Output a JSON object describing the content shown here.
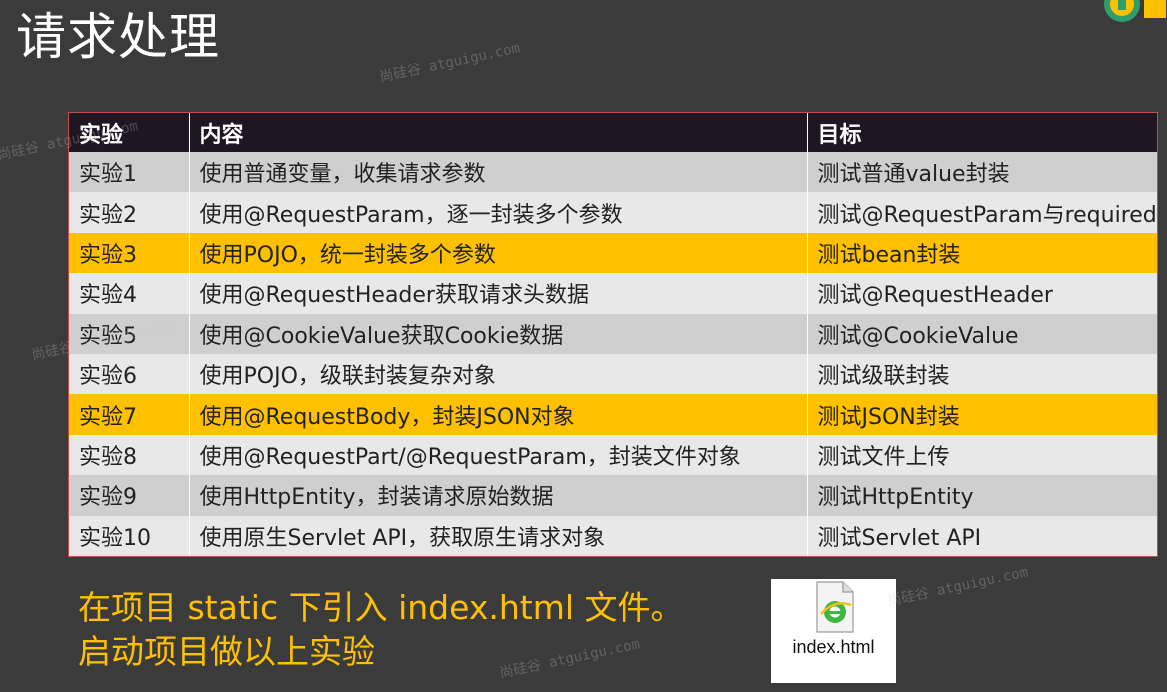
{
  "slide": {
    "title": "请求处理"
  },
  "table": {
    "headers": [
      "实验",
      "内容",
      "目标"
    ],
    "rows": [
      {
        "c1": "实验1",
        "c2": "使用普通变量，收集请求参数",
        "c3": "测试普通value封装",
        "highlight": false
      },
      {
        "c1": "实验2",
        "c2": "使用@RequestParam，逐一封装多个参数",
        "c3": "测试@RequestParam与required",
        "highlight": false
      },
      {
        "c1": "实验3",
        "c2": "使用POJO，统一封装多个参数",
        "c3": "测试bean封装",
        "highlight": true
      },
      {
        "c1": "实验4",
        "c2": "使用@RequestHeader获取请求头数据",
        "c3": "测试@RequestHeader",
        "highlight": false
      },
      {
        "c1": "实验5",
        "c2": "使用@CookieValue获取Cookie数据",
        "c3": "测试@CookieValue",
        "highlight": false
      },
      {
        "c1": "实验6",
        "c2": "使用POJO，级联封装复杂对象",
        "c3": "测试级联封装",
        "highlight": false
      },
      {
        "c1": "实验7",
        "c2": "使用@RequestBody，封装JSON对象",
        "c3": "测试JSON封装",
        "highlight": true
      },
      {
        "c1": "实验8",
        "c2": "使用@RequestPart/@RequestParam，封装文件对象",
        "c3": "测试文件上传",
        "highlight": false
      },
      {
        "c1": "实验9",
        "c2": "使用HttpEntity，封装请求原始数据",
        "c3": "测试HttpEntity",
        "highlight": false
      },
      {
        "c1": "实验10",
        "c2": "使用原生Servlet API，获取原生请求对象",
        "c3": "测试Servlet API",
        "highlight": false
      }
    ]
  },
  "notes": {
    "line1": "在项目 static 下引入 index.html 文件。",
    "line2": "启动项目做以上实验"
  },
  "file": {
    "name": "index.html",
    "icon": "ie-html-file-icon"
  },
  "watermark": "尚硅谷 atguigu.com",
  "colors": {
    "background": "#3b3b3b",
    "header": "#1f1623",
    "highlight": "#ffc000",
    "row_odd": "#cfcfcf",
    "row_even": "#e8e8e8",
    "note_text": "#ffc000"
  }
}
